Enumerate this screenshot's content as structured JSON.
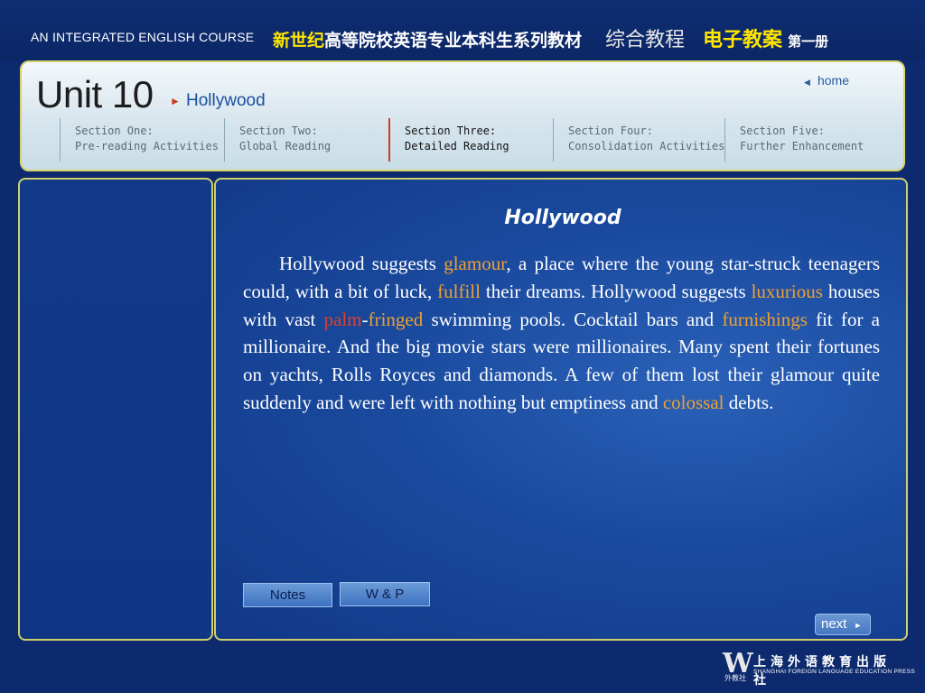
{
  "header": {
    "course": "AN INTEGRATED ENGLISH COURSE",
    "cn_brand": "新世纪",
    "cn_series": "高等院校英语专业本科生系列教材",
    "cn_book": "综合教程",
    "cn_ecase": "电子教案",
    "cn_volume": "第一册"
  },
  "unit": {
    "title": "Unit 10",
    "subtitle": "Hollywood",
    "home_label": "home"
  },
  "sections": [
    {
      "line1": "Section One:",
      "line2": "Pre-reading Activities"
    },
    {
      "line1": "Section Two:",
      "line2": "Global Reading"
    },
    {
      "line1": "Section Three:",
      "line2": "Detailed Reading"
    },
    {
      "line1": "Section Four:",
      "line2": "Consolidation Activities"
    },
    {
      "line1": "Section Five:",
      "line2": "Further Enhancement"
    }
  ],
  "active_section": "Section Three:",
  "article": {
    "title": "Hollywood",
    "t1": "Hollywood suggests ",
    "k1": "glamour",
    "t2": ", a place where the young star-struck teenagers could, with a bit of luck, ",
    "k2": "fulfill",
    "t3": " their dreams. Hollywood suggests ",
    "k3": "luxurious",
    "t4": " houses with vast ",
    "k4a": "palm",
    "k4b": "-",
    "k4c": "fringed",
    "t5": " swimming pools. Cocktail bars and ",
    "k5": "furnishings",
    "t6": " fit for a millionaire. And the big movie stars were millionaires. Many spent their fortunes on yachts, Rolls Royces and diamonds. A few of them lost their glamour quite suddenly and were left with nothing but emptiness and  ",
    "k6": "colossal",
    "t7": " debts."
  },
  "buttons": {
    "notes": "Notes",
    "wp": "W & P",
    "next": "next"
  },
  "publisher": {
    "logo": "W",
    "logo_sub": "外教社",
    "cn": "上海外语教育出版社",
    "en": "SHANGHAI FOREIGN LANGUAGE EDUCATION PRESS"
  },
  "colors": {
    "keyword_orange": "#f0a030",
    "keyword_red": "#e0402a",
    "panel_border": "#cfd06a",
    "brand_yellow": "#ffe600"
  }
}
